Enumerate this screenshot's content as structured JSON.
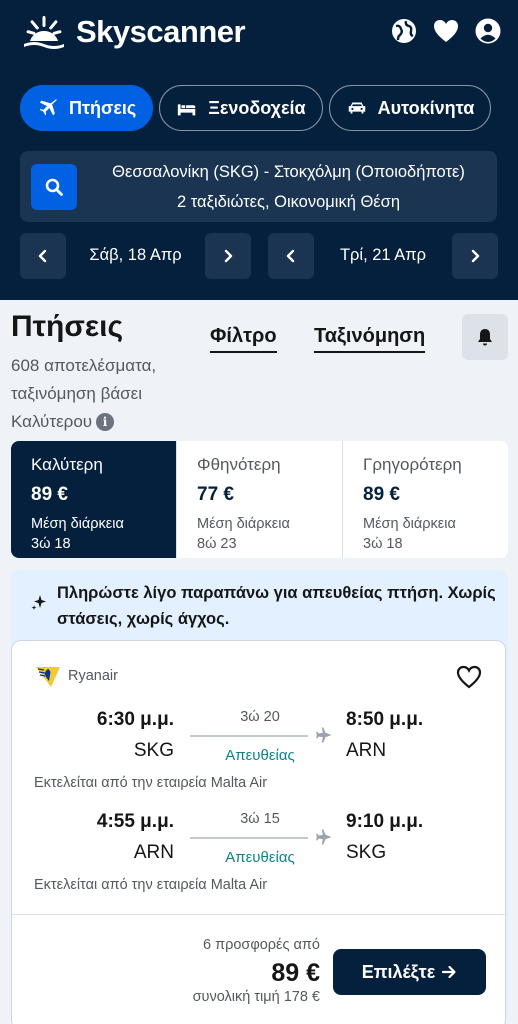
{
  "header": {
    "brand": "Skyscanner",
    "icons": [
      "globe-icon",
      "heart-icon",
      "account-icon"
    ]
  },
  "tabs": [
    {
      "label": "Πτήσεις",
      "icon": "plane-icon",
      "active": true
    },
    {
      "label": "Ξενοδοχεία",
      "icon": "bed-icon",
      "active": false
    },
    {
      "label": "Αυτοκίνητα",
      "icon": "car-icon",
      "active": false
    }
  ],
  "search": {
    "route": "Θεσσαλονίκη (SKG) - Στοκχόλμη (Οποιοδήποτε)",
    "details": "2 ταξιδιώτες, Οικονομική Θέση"
  },
  "dates": {
    "outbound": "Σάβ, 18 Απρ",
    "return": "Τρί, 21 Απρ"
  },
  "results": {
    "title": "Πτήσεις",
    "subtitle": "608 αποτελέσματα, ταξινόμηση βάσει Καλύτερου",
    "filter_label": "Φίλτρο",
    "sort_label": "Ταξινόμηση"
  },
  "sort_tabs": [
    {
      "title": "Καλύτερη",
      "price": "89 €",
      "avg_label": "Μέση διάρκεια",
      "avg_value": "3ώ 18",
      "active": true
    },
    {
      "title": "Φθηνότερη",
      "price": "77 €",
      "avg_label": "Μέση διάρκεια",
      "avg_value": "8ώ 23",
      "active": false
    },
    {
      "title": "Γρηγορότερη",
      "price": "89 €",
      "avg_label": "Μέση διάρκεια",
      "avg_value": "3ώ 18",
      "active": false
    }
  ],
  "promo": {
    "text": "Πληρώστε λίγο παραπάνω για απευθείας πτήση. Χωρίς στάσεις, χωρίς άγχος."
  },
  "flight_card": {
    "airline": "Ryanair",
    "legs": [
      {
        "dep_time": "6:30 μ.μ.",
        "dep_code": "SKG",
        "duration": "3ώ 20",
        "stops": "Απευθείας",
        "arr_time": "8:50 μ.μ.",
        "arr_code": "ARN",
        "operated": "Εκτελείται από την εταιρεία Malta Air"
      },
      {
        "dep_time": "4:55 μ.μ.",
        "dep_code": "ARN",
        "duration": "3ώ 15",
        "stops": "Απευθείας",
        "arr_time": "9:10 μ.μ.",
        "arr_code": "SKG",
        "operated": "Εκτελείται από την εταιρεία Malta Air"
      }
    ],
    "offers": "6 προσφορές από",
    "price": "89 €",
    "total": "συνολική τιμή 178 €",
    "select_label": "Επιλέξτε"
  },
  "colors": {
    "header_bg": "#05203c",
    "accent": "#0062e3",
    "direct_text": "#0c838a",
    "promo_bg": "#e3f0ff"
  }
}
